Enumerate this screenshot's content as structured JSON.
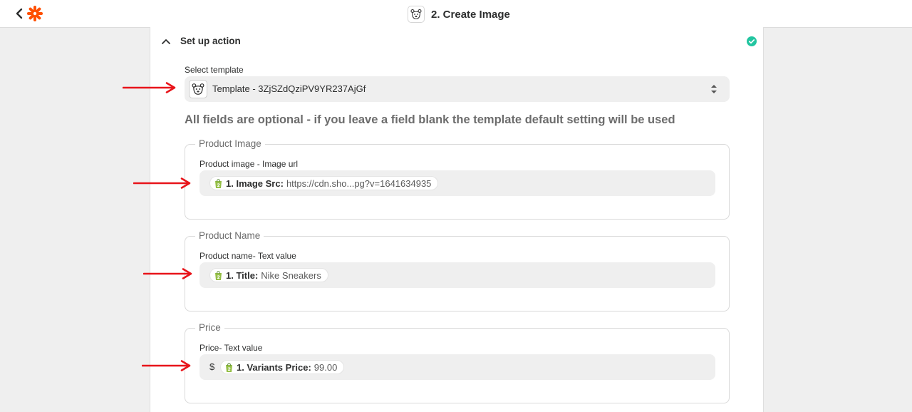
{
  "header": {
    "title": "2. Create Image",
    "back_icon": "chevron-left-icon",
    "logo_icon": "zapier-logo",
    "app_icon": "bear-icon"
  },
  "section": {
    "title": "Set up action",
    "status": "complete",
    "status_color": "#22c5a0"
  },
  "select_template": {
    "label": "Select template",
    "value": "Template - 3ZjSZdQziPV9YR237AjGf"
  },
  "note": "All fields are optional - if you leave a field blank the template default setting will be used",
  "groups": [
    {
      "legend": "Product Image",
      "label": "Product image - Image url",
      "prefix": "",
      "pill": {
        "key": "1. Image Src:",
        "value": "https://cdn.sho...pg?v=1641634935"
      }
    },
    {
      "legend": "Product Name",
      "label": "Product name- Text value",
      "prefix": "",
      "pill": {
        "key": "1. Title:",
        "value": "Nike Sneakers"
      }
    },
    {
      "legend": "Price",
      "label": "Price- Text value",
      "prefix": "$",
      "pill": {
        "key": "1. Variants Price:",
        "value": "99.00"
      }
    }
  ],
  "colors": {
    "accent": "#ff4f00",
    "arrow": "#e8141a",
    "shopify": "#95bf47"
  }
}
